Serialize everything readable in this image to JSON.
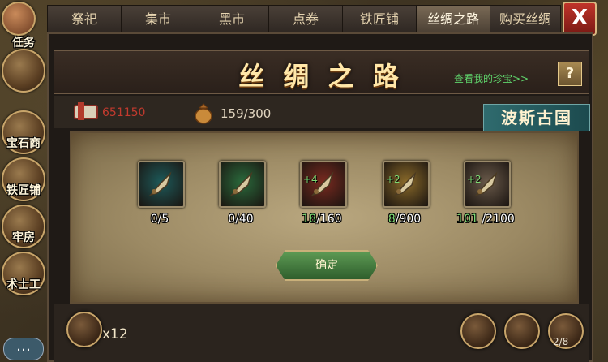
{
  "tabs": [
    "祭祀",
    "集市",
    "黑市",
    "点券",
    "铁匠铺",
    "丝绸之路",
    "购买丝绸"
  ],
  "active_tab": "丝绸之路",
  "close_label": "X",
  "sidebar": {
    "labels": [
      "任务",
      "宝石商",
      "铁匠铺",
      "牢房",
      "术士工"
    ]
  },
  "panel": {
    "title": "丝 绸 之 路",
    "treasure_link": "查看我的珍宝>>",
    "help_label": "?"
  },
  "resources": {
    "score": "651150",
    "bag": "159/300",
    "region": "波斯古国"
  },
  "items": [
    {
      "icon": "dagger-icon",
      "have": "0",
      "need": "/5",
      "plus": "",
      "have_color": "#ffffff",
      "frame": "#1d5a5a"
    },
    {
      "icon": "gauntlet-icon",
      "have": "0",
      "need": "/40",
      "plus": "",
      "have_color": "#ffffff",
      "frame": "#2a6a3c"
    },
    {
      "icon": "blade-icon",
      "have": "18",
      "need": "/160",
      "plus": "+4",
      "have_color": "#7dd873",
      "frame": "#7a2a20"
    },
    {
      "icon": "bracer-icon",
      "have": "8",
      "need": "/900",
      "plus": "+2",
      "have_color": "#7dd873",
      "frame": "#8a6a2a"
    },
    {
      "icon": "armor-icon",
      "have": "101",
      "need": " /2100",
      "plus": "+2",
      "have_color": "#7dd873",
      "frame": "#6a5a4a"
    }
  ],
  "confirm_label": "确定",
  "bottom": {
    "multiplier": "x12",
    "page": "2/8"
  }
}
